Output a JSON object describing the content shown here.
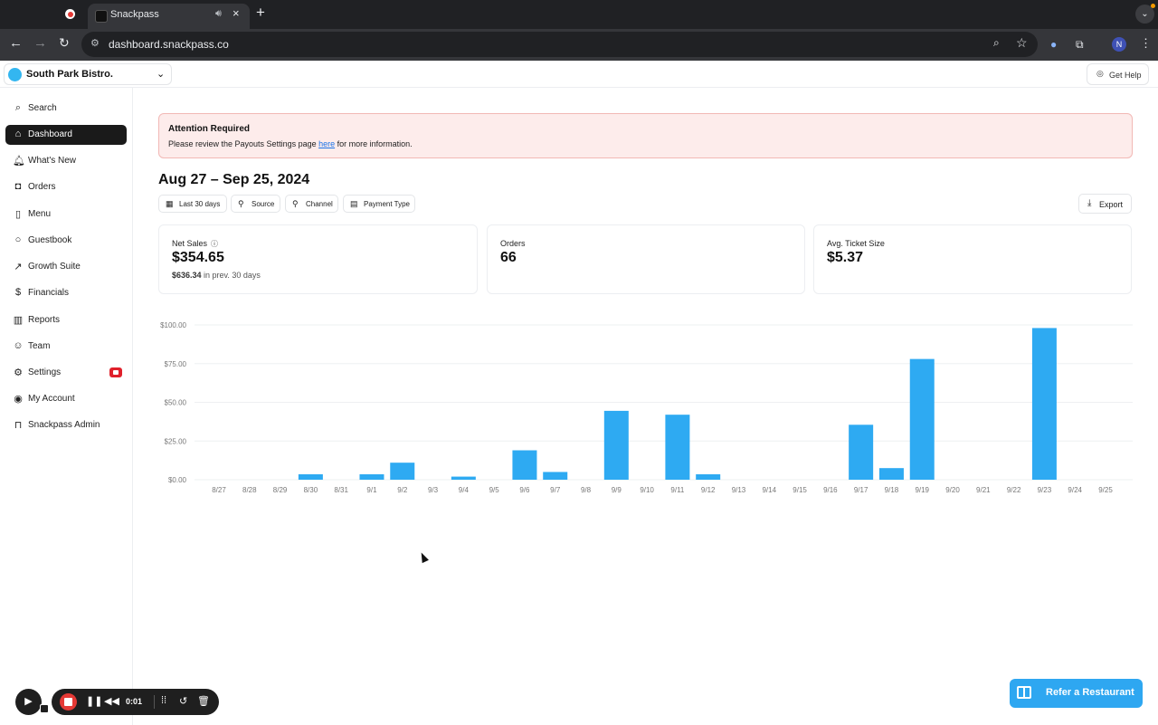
{
  "browser": {
    "tab_title": "Snackpass",
    "url": "dashboard.snackpass.co",
    "profile_initial": "N",
    "icons": {
      "recording": "record-icon",
      "audio": "speaker-icon",
      "close": "close-icon",
      "new_tab": "plus-icon",
      "back": "arrow-left-icon",
      "forward": "arrow-right-icon",
      "reload": "reload-icon",
      "site_info": "tune-icon",
      "zoom": "zoom-icon",
      "bookmark": "star-icon",
      "extension_one": "extension-icon",
      "extensions": "puzzle-icon",
      "menu": "kebab-menu-icon"
    }
  },
  "header": {
    "store_name": "South Park Bistro.",
    "help_label": "Get Help"
  },
  "sidebar": {
    "items": [
      {
        "label": "Search",
        "icon": "search-icon"
      },
      {
        "label": "Dashboard",
        "icon": "home-icon",
        "active": true
      },
      {
        "label": "What's New",
        "icon": "bell-icon"
      },
      {
        "label": "Orders",
        "icon": "bag-icon"
      },
      {
        "label": "Menu",
        "icon": "book-icon"
      },
      {
        "label": "Guestbook",
        "icon": "chat-icon"
      },
      {
        "label": "Growth Suite",
        "icon": "rocket-icon"
      },
      {
        "label": "Financials",
        "icon": "dollar-icon"
      },
      {
        "label": "Reports",
        "icon": "bar-chart-icon"
      },
      {
        "label": "Team",
        "icon": "team-icon"
      },
      {
        "label": "Settings",
        "icon": "gear-icon",
        "badge": true
      },
      {
        "label": "My Account",
        "icon": "user-icon"
      },
      {
        "label": "Snackpass Admin",
        "icon": "lock-icon"
      }
    ]
  },
  "alert": {
    "title": "Attention Required",
    "text_before": "Please review the Payouts Settings page ",
    "link_text": "here",
    "text_after": " for more information."
  },
  "date_range": "Aug 27 – Sep 25, 2024",
  "filters": [
    {
      "label": "Last 30 days",
      "icon": "calendar-icon"
    },
    {
      "label": "Source",
      "icon": "filter-icon"
    },
    {
      "label": "Channel",
      "icon": "filter-icon"
    },
    {
      "label": "Payment Type",
      "icon": "wallet-icon"
    }
  ],
  "export_label": "Export",
  "cards": [
    {
      "label": "Net Sales",
      "value": "$354.65",
      "prev_value": "$636.34",
      "prev_text": " in prev. 30 days"
    },
    {
      "label": "Orders",
      "value": "66"
    },
    {
      "label": "Avg. Ticket Size",
      "value": "$5.37"
    }
  ],
  "chart_data": {
    "type": "bar",
    "categories": [
      "8/27",
      "8/28",
      "8/29",
      "8/30",
      "8/31",
      "9/1",
      "9/2",
      "9/3",
      "9/4",
      "9/5",
      "9/6",
      "9/7",
      "9/8",
      "9/9",
      "9/10",
      "9/11",
      "9/12",
      "9/13",
      "9/14",
      "9/15",
      "9/16",
      "9/17",
      "9/18",
      "9/19",
      "9/20",
      "9/21",
      "9/22",
      "9/23",
      "9/24",
      "9/25"
    ],
    "values": [
      0,
      0,
      0,
      3.5,
      0,
      3.5,
      11,
      0,
      2,
      0,
      19,
      5,
      0,
      44.5,
      0,
      42,
      3.5,
      0,
      0,
      0,
      0,
      35.5,
      7.5,
      78,
      0,
      0,
      0,
      98,
      0,
      0
    ],
    "yticks": [
      "$100.00",
      "$75.00",
      "$50.00",
      "$25.00",
      "$0.00"
    ],
    "ylim": [
      0,
      100
    ],
    "grid": true,
    "color": "#2eaaf2"
  },
  "recorder": {
    "time": "0:01"
  },
  "refer_label": "Refer a Restaurant"
}
